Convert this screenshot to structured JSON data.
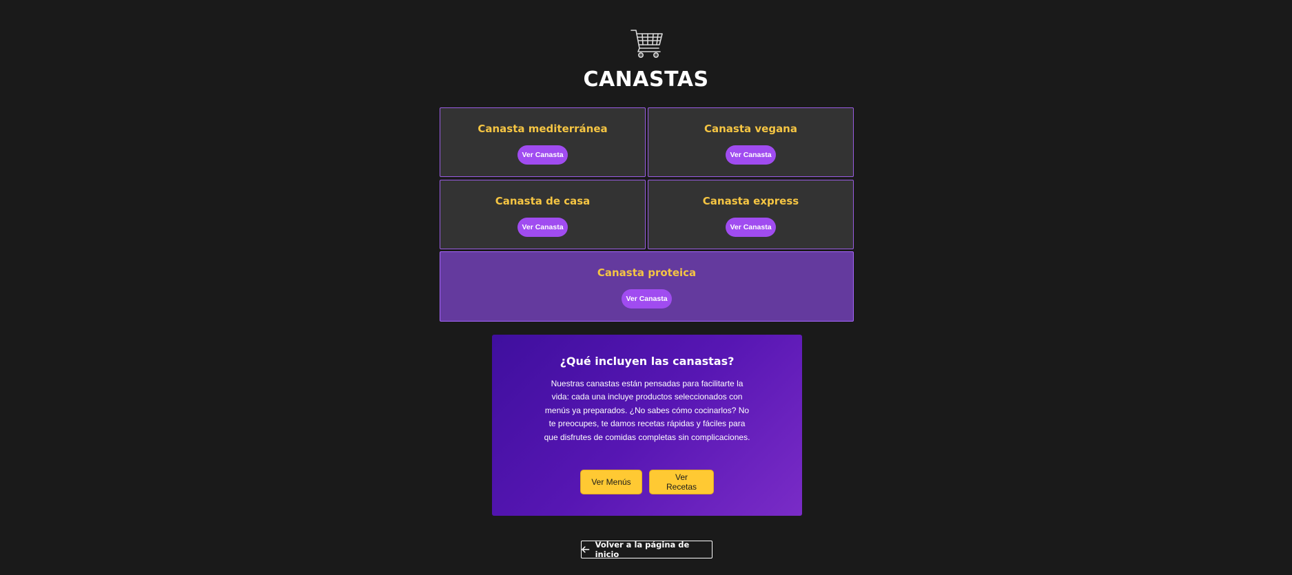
{
  "header": {
    "icon": "shopping-cart-icon",
    "title": "CANASTAS"
  },
  "baskets": [
    {
      "name": "Canasta mediterránea",
      "button_label": "Ver Canasta"
    },
    {
      "name": "Canasta vegana",
      "button_label": "Ver Canasta"
    },
    {
      "name": "Canasta de casa",
      "button_label": "Ver Canasta"
    },
    {
      "name": "Canasta express",
      "button_label": "Ver Canasta"
    },
    {
      "name": "Canasta proteica",
      "button_label": "Ver Canasta"
    }
  ],
  "info": {
    "title": "¿Qué incluyen las canastas?",
    "text": "Nuestras canastas están pensadas para facilitarte la vida: cada una incluye productos seleccionados con menús ya preparados. ¿No sabes cómo cocinarlos? No te preocupes, te damos recetas rápidas y fáciles para que disfrutes de comidas completas sin complicaciones.",
    "menus_button": "Ver Menús",
    "recipes_button": "Ver Recetas"
  },
  "back_link": {
    "icon": "arrow-left-icon",
    "label": "Volver a la página de inicio"
  },
  "colors": {
    "background": "#1a1a1a",
    "card": "#333333",
    "card_border": "#9b5de5",
    "highlight_card": "#643a9e",
    "accent_yellow": "#f5c543",
    "button_purple": "#a04cf0",
    "info_gradient_start": "#3f0f9e",
    "info_gradient_end": "#7a2cc7",
    "yellow_button": "#ffc933"
  }
}
